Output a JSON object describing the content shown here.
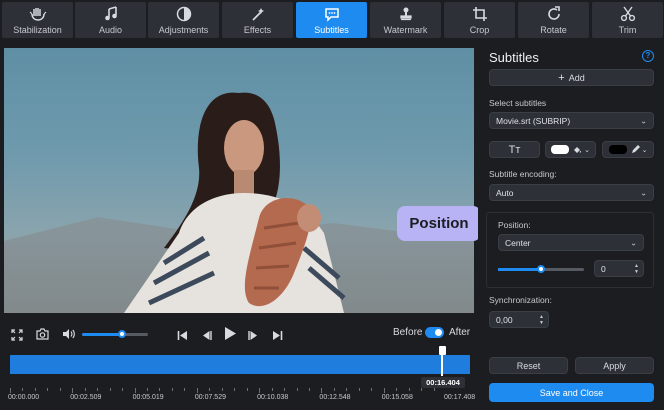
{
  "toolbar": {
    "tabs": [
      {
        "label": "Stabilization",
        "icon": "stabilization-icon"
      },
      {
        "label": "Audio",
        "icon": "music-note-icon"
      },
      {
        "label": "Adjustments",
        "icon": "adjustments-icon"
      },
      {
        "label": "Effects",
        "icon": "magic-wand-icon"
      },
      {
        "label": "Subtitles",
        "icon": "speech-bubble-icon",
        "active": true
      },
      {
        "label": "Watermark",
        "icon": "stamp-icon"
      },
      {
        "label": "Crop",
        "icon": "crop-icon"
      },
      {
        "label": "Rotate",
        "icon": "rotate-icon"
      },
      {
        "label": "Trim",
        "icon": "scissors-icon"
      }
    ]
  },
  "preview": {
    "tooltip": "Position"
  },
  "player": {
    "volume_level": 0.6,
    "before_label": "Before",
    "after_label": "After",
    "before_after_on": true
  },
  "timeline": {
    "current_time": "00:16.404",
    "position_fraction": 0.94,
    "ticks": [
      "00:00.000",
      "00:02.509",
      "00:05.019",
      "00:07.529",
      "00:10.038",
      "00:12.548",
      "00:15.058",
      "00:17.408"
    ]
  },
  "panel": {
    "title": "Subtitles",
    "help": "?",
    "add_label": "Add",
    "select_label": "Select subtitles",
    "select_value": "Movie.srt (SUBRIP)",
    "font_icon": "Tт",
    "encoding_label": "Subtitle encoding:",
    "encoding_value": "Auto",
    "position_label": "Position:",
    "position_value": "Center",
    "position_slider": 0.5,
    "position_number": "0",
    "sync_label": "Synchronization:",
    "sync_value": "0,00",
    "reset_label": "Reset",
    "apply_label": "Apply",
    "save_label": "Save and Close"
  },
  "colors": {
    "accent": "#1e8bf0",
    "tooltip": "#b7b3f4",
    "background": "#1b1d21"
  }
}
